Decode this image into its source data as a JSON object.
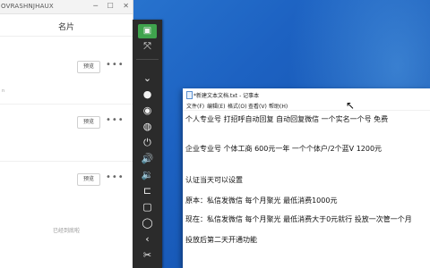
{
  "left_window": {
    "title": "OVRASHNJHAUX",
    "header_title": "名片",
    "cards": [
      {
        "preview": "预览",
        "more": "•••",
        "meta": "n"
      },
      {
        "preview": "预览",
        "more": "•••",
        "meta": ""
      },
      {
        "preview": "预览",
        "more": "•••",
        "meta": ""
      }
    ],
    "footer": "已经到底啦"
  },
  "toolbar": {
    "buttons": [
      "▣",
      "⤧",
      "⌄",
      "●",
      "◉",
      "◍",
      "⏻",
      "🔊",
      "🔉",
      "⊏",
      "▢",
      "◯",
      "‹",
      "✂"
    ]
  },
  "notepad": {
    "title": "*新建文本文档.txt - 记事本",
    "menu": [
      "文件(F)",
      "编辑(E)",
      "格式(O)",
      "查看(V)",
      "帮助(H)"
    ],
    "lines": [
      "个人专业号   打招呼自动回复    自动回复微信   一个实名一个号  免费",
      "企业专业号 个体工商   600元一年    一个个体户/2个蓝V    1200元",
      "认证当天可以设置",
      "原本：私信发微信   每个月聚光  最低消费1000元",
      "现在：私信发微信   每个月聚光  最低消费大于0元就行  投放一次管一个月",
      "投放后第二天开通功能"
    ]
  }
}
